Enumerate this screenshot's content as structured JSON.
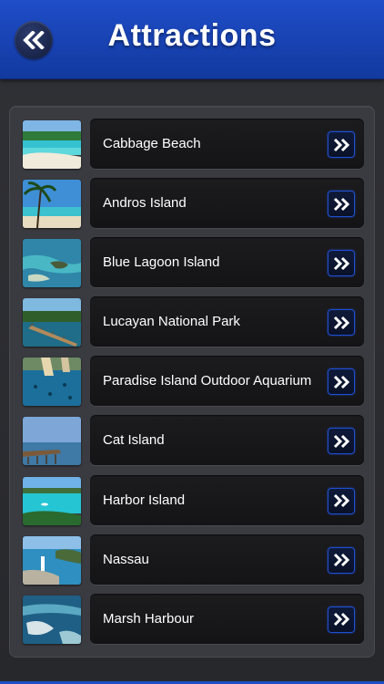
{
  "header": {
    "title": "Attractions",
    "back_icon": "double-chevron-left-icon",
    "color": "#1c48bd"
  },
  "attractions": [
    {
      "label": "Cabbage Beach",
      "thumb": "beach"
    },
    {
      "label": "Andros Island",
      "thumb": "palm"
    },
    {
      "label": "Blue Lagoon Island",
      "thumb": "lagoon"
    },
    {
      "label": "Lucayan National Park",
      "thumb": "boardwalk"
    },
    {
      "label": "Paradise Island Outdoor Aquarium",
      "thumb": "aquarium"
    },
    {
      "label": "Cat Island",
      "thumb": "pier"
    },
    {
      "label": "Harbor Island",
      "thumb": "harbor"
    },
    {
      "label": "Nassau",
      "thumb": "lighthouse"
    },
    {
      "label": "Marsh Harbour",
      "thumb": "aerial"
    }
  ],
  "item_action_icon": "double-chevron-right-icon",
  "accent_color": "#1f4fd4"
}
